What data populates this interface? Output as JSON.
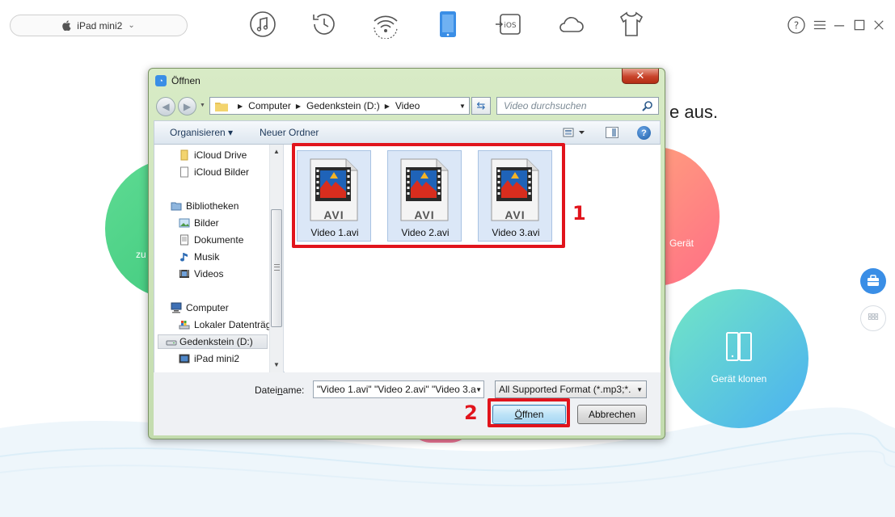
{
  "app": {
    "device_name": "iPad mini2",
    "headline_fragment": "e aus.",
    "circles": {
      "left_label_fragment": "zu",
      "right_label": "Gerät",
      "clone_label": "Gerät klonen"
    },
    "nav_icons": [
      "music-icon",
      "history-icon",
      "wifi-icon",
      "device-icon",
      "ios-icon",
      "cloud-icon",
      "shirt-icon"
    ],
    "window_controls": {
      "help": "?",
      "menu": "☰",
      "minimize": "—",
      "maximize": "☐",
      "close": "✕"
    },
    "colors": {
      "accent_blue": "#3a8ee6",
      "green": "#4cd68a",
      "coral": "#ff8a7a",
      "teal": "#5ec8e8"
    }
  },
  "dialog": {
    "title": "Öffnen",
    "close_label": "✕",
    "breadcrumb": [
      "Computer",
      "Gedenkstein (D:)",
      "Video"
    ],
    "search_placeholder": "Video durchsuchen",
    "toolbar": {
      "organize": "Organisieren ▾",
      "new_folder": "Neuer Ordner",
      "help": "?"
    },
    "nav_items": [
      {
        "label": "iCloud Drive",
        "icon": "folder-icon"
      },
      {
        "label": "iCloud Bilder",
        "icon": "document-icon"
      },
      {
        "label": "Bibliotheken",
        "icon": "library-icon"
      },
      {
        "label": "Bilder",
        "icon": "pictures-icon"
      },
      {
        "label": "Dokumente",
        "icon": "documents-icon"
      },
      {
        "label": "Musik",
        "icon": "music-note-icon"
      },
      {
        "label": "Videos",
        "icon": "video-icon"
      },
      {
        "label": "Computer",
        "icon": "computer-icon"
      },
      {
        "label": "Lokaler Datenträger",
        "icon": "drive-icon"
      },
      {
        "label": "Gedenkstein (D:)",
        "icon": "drive-icon",
        "selected": true
      },
      {
        "label": "iPad mini2",
        "icon": "ipad-icon"
      }
    ],
    "files": [
      {
        "name": "Video 1.avi",
        "type_label": "AVI"
      },
      {
        "name": "Video 2.avi",
        "type_label": "AVI"
      },
      {
        "name": "Video 3.avi",
        "type_label": "AVI"
      }
    ],
    "filename_label_pre": "Datei",
    "filename_label_ul": "n",
    "filename_label_post": "ame:",
    "filename_value": "\"Video 1.avi\" \"Video 2.avi\" \"Video 3.a",
    "filter_value": "All Supported Format (*.mp3;*.",
    "open_label_ul": "Ö",
    "open_label_rest": "ffnen",
    "cancel_label": "Abbrechen"
  },
  "annotations": {
    "step1": "1",
    "step2": "2",
    "color": "#e1141c"
  }
}
